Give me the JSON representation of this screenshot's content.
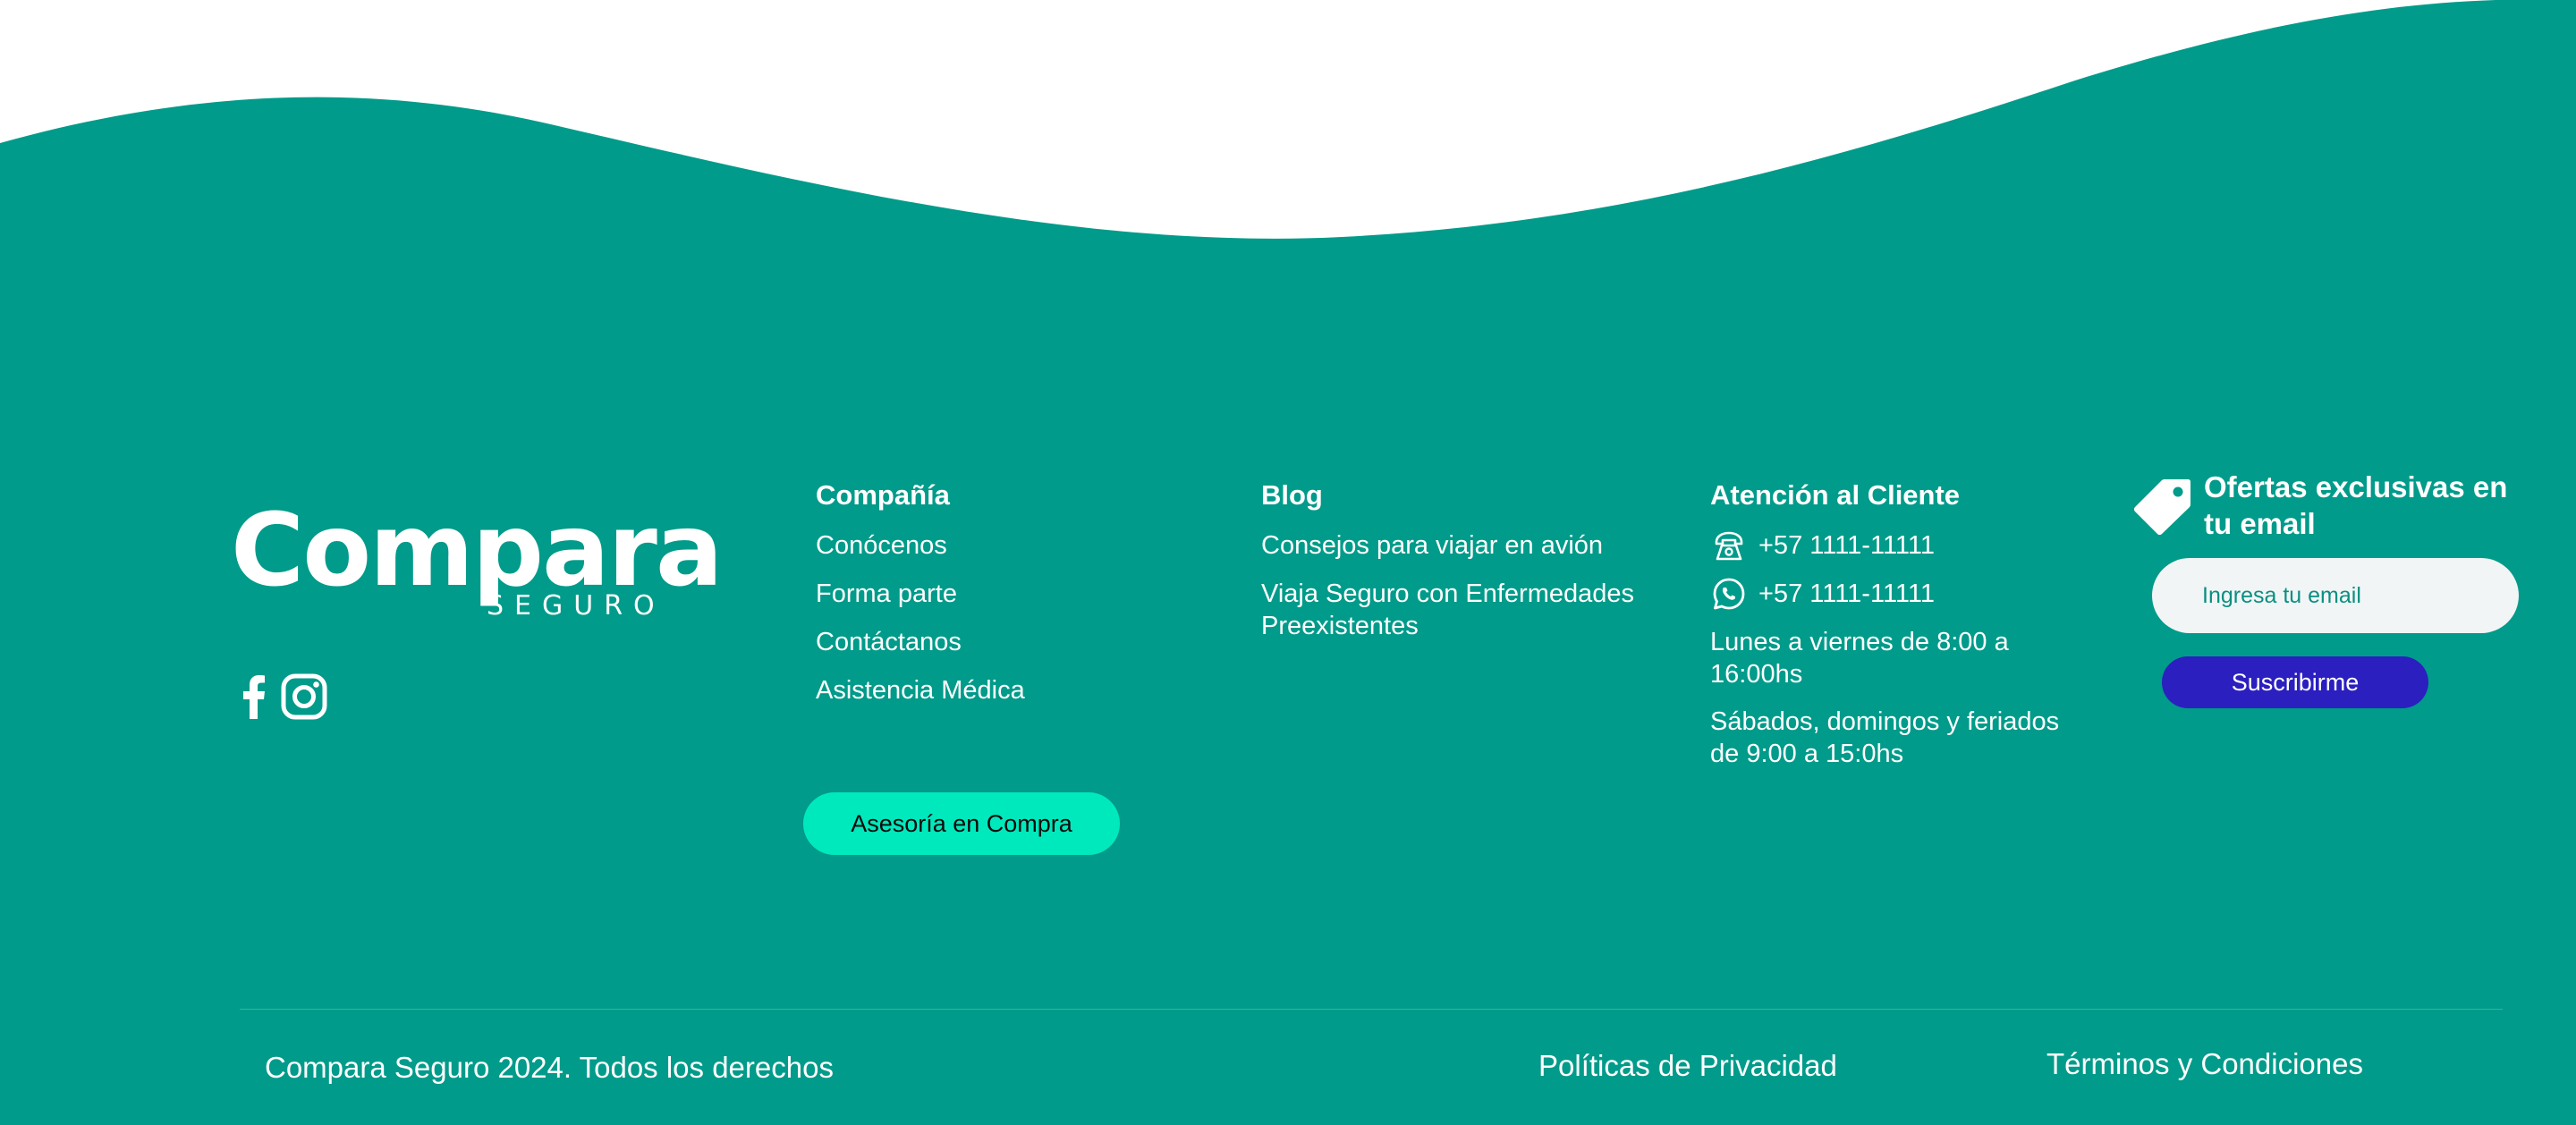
{
  "colors": {
    "footer_background": "#009b8a",
    "accent_button": "#00e9bd",
    "subscribe_button": "#2b1fbf",
    "text": "#ffffff",
    "input_background": "#f2f5f5"
  },
  "brand": {
    "logo_word": "Compara",
    "logo_sub": "SEGURO"
  },
  "social": {
    "items": [
      {
        "icon": "facebook-icon"
      },
      {
        "icon": "instagram-icon"
      }
    ]
  },
  "company": {
    "title": "Compañía",
    "links": [
      "Conócenos",
      "Forma parte",
      "Contáctanos",
      "Asistencia Médica"
    ],
    "cta": "Asesoría en Compra"
  },
  "blog": {
    "title": "Blog",
    "links": [
      "Consejos para viajar en avión",
      "Viaja Seguro con Enfermedades Preexistentes"
    ]
  },
  "support": {
    "title": "Atención al Cliente",
    "phone": {
      "icon": "phone-icon",
      "text": "+57 1111-11111"
    },
    "whatsapp": {
      "icon": "whatsapp-icon",
      "text": "+57 1111-11111"
    },
    "hours_weekdays": "Lunes a viernes de 8:00 a 16:00hs",
    "hours_weekend": "Sábados, domingos y feriados de 9:00 a 15:0hs"
  },
  "newsletter": {
    "icon": "tag-icon",
    "title": "Ofertas exclusivas en tu email",
    "input_placeholder": "Ingresa tu email",
    "input_value": "",
    "button": "Suscribirme"
  },
  "bottom": {
    "copyright": "Compara Seguro 2024. Todos los derechos",
    "privacy": "Políticas de Privacidad",
    "terms": "Términos y Condiciones"
  }
}
